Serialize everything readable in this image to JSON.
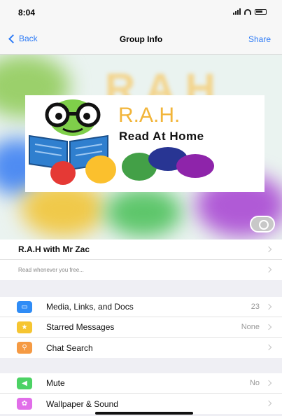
{
  "status_bar": {
    "time": "8:04"
  },
  "nav": {
    "back_label": "Back",
    "title": "Group Info",
    "share_label": "Share"
  },
  "cover": {
    "logo_title": "R.A.H.",
    "logo_subtitle": "Read At Home"
  },
  "group": {
    "name": "R.A.H with Mr Zac",
    "description": "Read whenever you free..."
  },
  "menu_primary": [
    {
      "label": "Media, Links, and Docs",
      "value": "23",
      "icon": "photo-icon",
      "color": "#2f8cf6"
    },
    {
      "label": "Starred Messages",
      "value": "None",
      "icon": "star-icon",
      "color": "#f6c531"
    },
    {
      "label": "Chat Search",
      "value": "",
      "icon": "search-icon",
      "color": "#f59a43"
    }
  ],
  "menu_secondary": [
    {
      "label": "Mute",
      "value": "No",
      "icon": "speaker-icon",
      "color": "#4cd264"
    },
    {
      "label": "Wallpaper & Sound",
      "value": "",
      "icon": "wallpaper-icon",
      "color": "#e16ee9"
    }
  ]
}
